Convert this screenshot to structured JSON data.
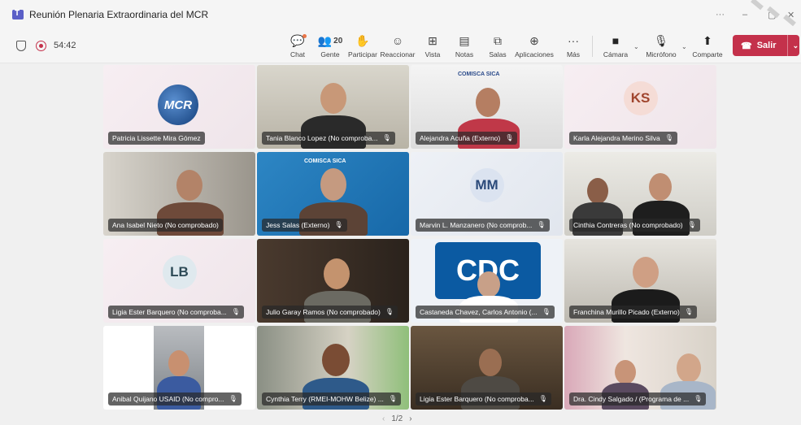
{
  "window": {
    "title": "Reunión Plenaria Extraordinaria del MCR",
    "more": "···",
    "minimize": "–",
    "restore": "▢",
    "close": "✕"
  },
  "toolbar": {
    "timer": "54:42",
    "chat": "Chat",
    "people": "Gente",
    "people_count": "20",
    "raise": "Participar",
    "react": "Reaccionar",
    "view": "Vista",
    "notes": "Notas",
    "rooms": "Salas",
    "apps": "Aplicaciones",
    "more": "Más",
    "camera": "Cámara",
    "mic": "Micrófono",
    "share": "Comparte",
    "leave": "Salir"
  },
  "tiles": [
    {
      "name": "Patricia Lissette Mira Gómez",
      "logo": "MCR"
    },
    {
      "name": "Tania Blanco Lopez (No comproba..."
    },
    {
      "name": "Alejandra Acuña (Externo)",
      "banner": "COMISCA  SICA"
    },
    {
      "name": "Karla Alejandra Merino Silva",
      "initials": "KS"
    },
    {
      "name": "Ana Isabel Nieto (No comprobado)"
    },
    {
      "name": "Jess Salas (Externo)",
      "banner": "COMISCA  SICA"
    },
    {
      "name": "Marvin L. Manzanero (No comprob...",
      "initials": "MM"
    },
    {
      "name": "Cinthia Contreras (No comprobado)"
    },
    {
      "name": "Ligia Ester Barquero (No comproba...",
      "initials": "LB"
    },
    {
      "name": "Julio Garay Ramos (No comprobado)"
    },
    {
      "name": "Castaneda Chavez, Carlos Antonio (...",
      "logo": "CDC"
    },
    {
      "name": "Franchina Murillo Picado (Externo)"
    },
    {
      "name": "Anibal Quijano USAID (No compro..."
    },
    {
      "name": "Cynthia Terry (RMEI-MOHW Belize) ..."
    },
    {
      "name": "Ligia Ester Barquero (No comproba..."
    },
    {
      "name": "Dra. Cindy Salgado / (Programa de ..."
    }
  ],
  "pager": {
    "prev": "‹",
    "label": "1/2",
    "next": "›"
  },
  "colors": {
    "accent": "#5b5fc7",
    "leave": "#c4314b",
    "recording": "#c4314b"
  }
}
